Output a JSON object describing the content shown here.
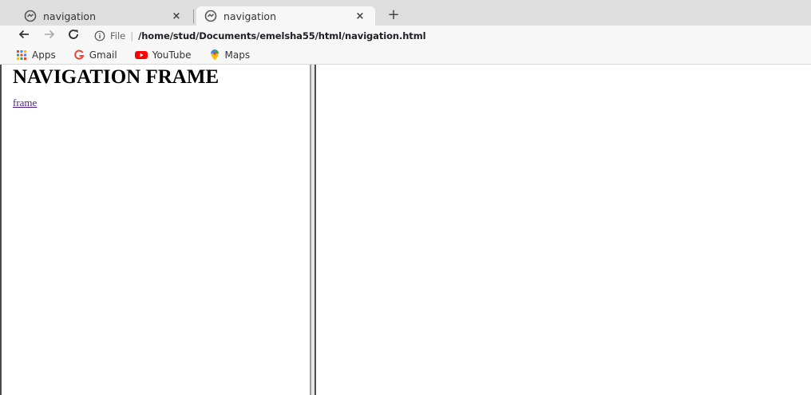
{
  "browser": {
    "tabs": [
      {
        "title": "navigation",
        "active": false,
        "close_label": "×",
        "favicon": "globe-icon"
      },
      {
        "title": "navigation",
        "active": true,
        "close_label": "×",
        "favicon": "globe-icon"
      }
    ],
    "new_tab_label": "+",
    "toolbar": {
      "back_icon": "arrow-left-icon",
      "forward_icon": "arrow-right-icon",
      "reload_icon": "reload-icon"
    },
    "omnibox": {
      "info_icon": "info-icon",
      "scheme_label": "File",
      "url": "/home/stud/Documents/emelsha55/html/navigation.html"
    },
    "bookmarks": [
      {
        "label": "Apps",
        "icon": "apps-grid-icon"
      },
      {
        "label": "Gmail",
        "icon": "google-g-icon"
      },
      {
        "label": "YouTube",
        "icon": "youtube-icon"
      },
      {
        "label": "Maps",
        "icon": "maps-pin-icon"
      }
    ]
  },
  "page": {
    "left_frame": {
      "heading": "NAVIGATION FRAME",
      "link_text": "frame"
    }
  },
  "colors": {
    "tabstrip_bg": "#dedede",
    "toolbar_bg": "#f7f7f7",
    "visited_link": "#551a8b",
    "youtube_red": "#ff0000"
  }
}
